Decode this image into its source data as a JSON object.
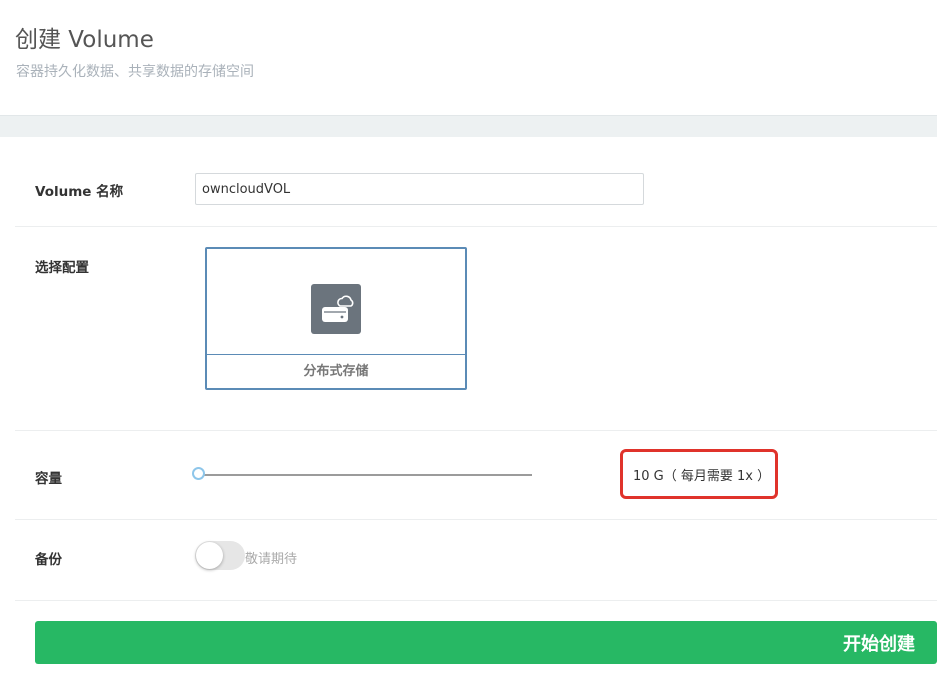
{
  "header": {
    "title": "创建 Volume",
    "subtitle": "容器持久化数据、共享数据的存储空间"
  },
  "form": {
    "name": {
      "label": "Volume 名称",
      "value": "owncloudVOL"
    },
    "config": {
      "label": "选择配置",
      "options": [
        {
          "label": "分布式存储",
          "icon": "cloud-drive-icon",
          "selected": true
        }
      ]
    },
    "capacity": {
      "label": "容量",
      "display": "10 G（ 每月需要 1x ）",
      "slider_fraction": 0
    },
    "backup": {
      "label": "备份",
      "enabled": false,
      "note": "敬请期待"
    }
  },
  "actions": {
    "create_label": "开始创建"
  },
  "colors": {
    "primary_green": "#27b864",
    "card_border": "#5b8bb6",
    "highlight_red": "#e0332b",
    "slider_handle": "#8ec6ea"
  }
}
